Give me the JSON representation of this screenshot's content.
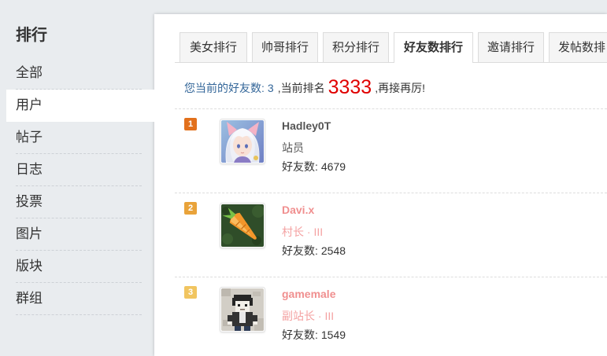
{
  "sidebar": {
    "title": "排行",
    "items": [
      {
        "label": "全部",
        "active": false
      },
      {
        "label": "用户",
        "active": true
      },
      {
        "label": "帖子",
        "active": false
      },
      {
        "label": "日志",
        "active": false
      },
      {
        "label": "投票",
        "active": false
      },
      {
        "label": "图片",
        "active": false
      },
      {
        "label": "版块",
        "active": false
      },
      {
        "label": "群组",
        "active": false
      }
    ]
  },
  "tabs": [
    {
      "label": "美女排行",
      "active": false
    },
    {
      "label": "帅哥排行",
      "active": false
    },
    {
      "label": "积分排行",
      "active": false
    },
    {
      "label": "好友数排行",
      "active": true
    },
    {
      "label": "邀请排行",
      "active": false
    },
    {
      "label": "发帖数排",
      "active": false
    }
  ],
  "summary": {
    "friends_label": "您当前的好友数:",
    "friends_count": "3",
    "rank_label": ",当前排名",
    "rank": "3333",
    "suffix": ",再接再厉!"
  },
  "ranking": [
    {
      "rank": "1",
      "name": "Hadley0T",
      "group": "站员",
      "friends_label": "好友数:",
      "friends": "4679",
      "avatar": "anime-girl-avatar",
      "badge_color": "#e2701c",
      "name_color": "#555555",
      "group_color": "#555555"
    },
    {
      "rank": "2",
      "name": "Davi.x",
      "group": "村长 · III",
      "friends_label": "好友数:",
      "friends": "2548",
      "avatar": "carrot-avatar",
      "badge_color": "#e9a33a",
      "name_color": "#f08f8f",
      "group_color": "#f4a2a2"
    },
    {
      "rank": "3",
      "name": "gamemale",
      "group": "副站长 · III",
      "friends_label": "好友数:",
      "friends": "1549",
      "avatar": "pixel-character-avatar",
      "badge_color": "#f1c560",
      "name_color": "#f08f8f",
      "group_color": "#f4a2a2"
    }
  ],
  "colors": {
    "sidebar_bg": "#e9ecef",
    "link": "#336699",
    "rank_highlight": "#e00000",
    "tab_bg": "#f5f5f5",
    "border": "#dddddd"
  }
}
